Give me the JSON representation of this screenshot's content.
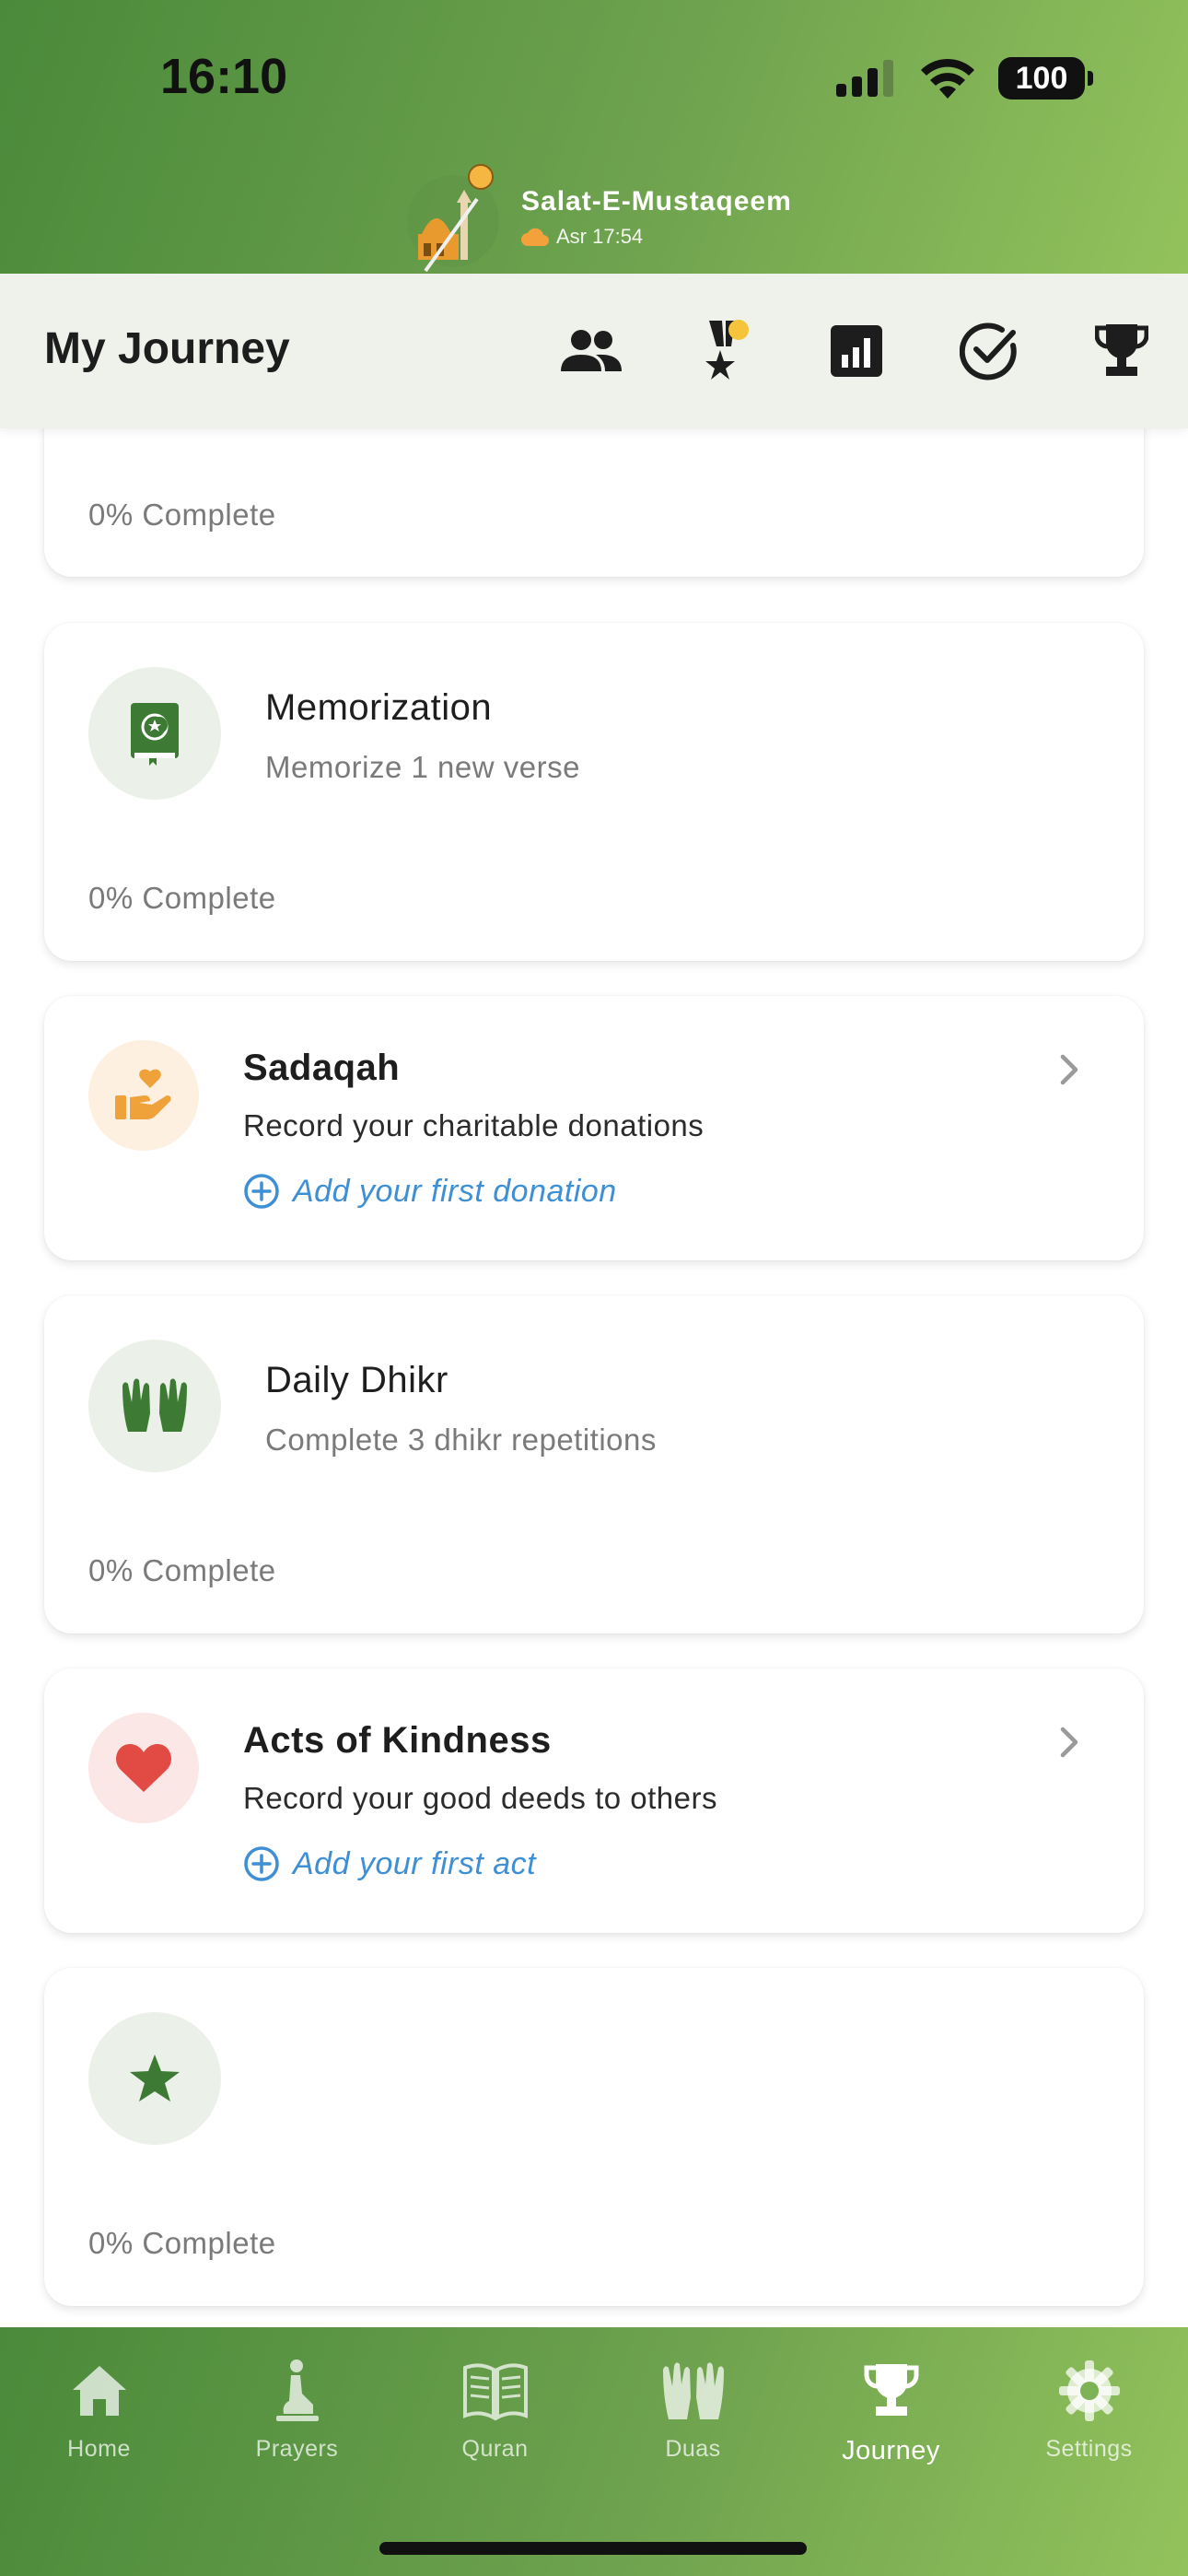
{
  "status_bar": {
    "time": "16:10",
    "battery": "100"
  },
  "brand": {
    "name": "Salat-E-Mustaqeem",
    "prayer": "Asr 17:54"
  },
  "journey_bar": {
    "title": "My Journey",
    "icons": [
      "people-icon",
      "medal-icon",
      "stats-icon",
      "check-circle-icon",
      "trophy-icon"
    ]
  },
  "cards": {
    "partial": {
      "progress": "0% Complete"
    },
    "memorization": {
      "title": "Memorization",
      "subtitle": "Memorize 1 new verse",
      "progress": "0% Complete",
      "icon": "quran-book-icon"
    },
    "sadaqah": {
      "title": "Sadaqah",
      "subtitle": "Record your charitable donations",
      "link": "Add your first donation",
      "icon": "charity-hand-icon"
    },
    "daily_dhikr": {
      "title": "Daily Dhikr",
      "subtitle": "Complete 3 dhikr repetitions",
      "progress": "0% Complete",
      "icon": "praying-hands-icon"
    },
    "kindness": {
      "title": "Acts of Kindness",
      "subtitle": "Record your good deeds to others",
      "link": "Add your first act",
      "icon": "heart-icon"
    },
    "star_goal": {
      "progress": "0% Complete",
      "icon": "star-icon"
    }
  },
  "bottom_nav": {
    "items": [
      {
        "label": "Home",
        "icon": "home-icon"
      },
      {
        "label": "Prayers",
        "icon": "prayer-person-icon"
      },
      {
        "label": "Quran",
        "icon": "open-book-icon"
      },
      {
        "label": "Duas",
        "icon": "dua-hands-icon"
      },
      {
        "label": "Journey",
        "icon": "trophy-icon"
      },
      {
        "label": "Settings",
        "icon": "gear-icon"
      }
    ],
    "active": "Journey"
  },
  "colors": {
    "brand_green_dark": "#4a8a3a",
    "brand_green_light": "#93c25c",
    "link_blue": "#3e8fd4",
    "icon_green": "#3d7b34",
    "kindness_red": "#e14b43",
    "sadaqah_orange": "#f0a23a"
  }
}
